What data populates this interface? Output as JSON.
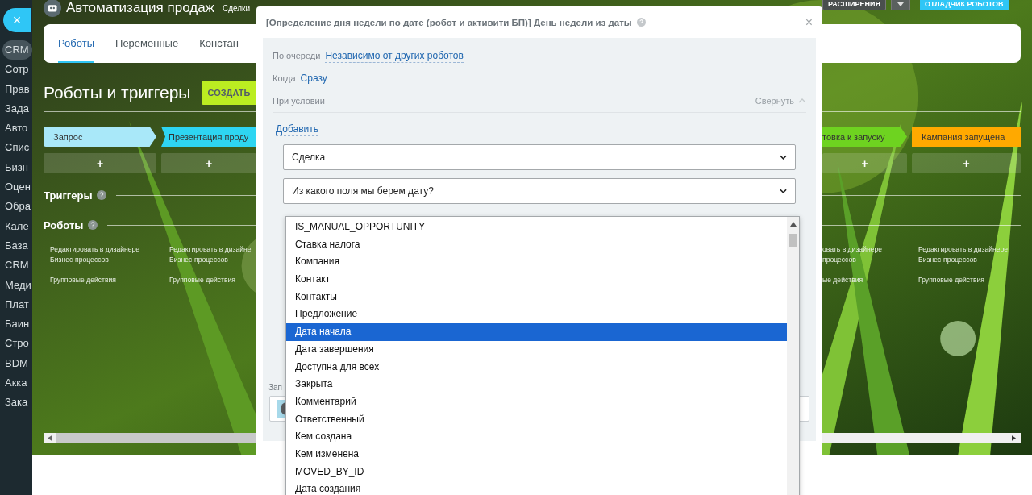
{
  "sidebar": {
    "close": "×",
    "items": [
      {
        "label": "CRM",
        "selected": true
      },
      {
        "label": "Сотр",
        "selected": false
      },
      {
        "label": "Прав",
        "selected": false
      },
      {
        "label": "Зада",
        "selected": false
      },
      {
        "label": "Авто",
        "selected": false
      },
      {
        "label": "Спис",
        "selected": false
      },
      {
        "label": "Бизн",
        "selected": false
      },
      {
        "label": "Оцен",
        "selected": false
      },
      {
        "label": "Обра",
        "selected": false
      },
      {
        "label": "Кале",
        "selected": false
      },
      {
        "label": "База",
        "selected": false
      },
      {
        "label": "CRM",
        "selected": false
      },
      {
        "label": "Меди",
        "selected": false
      },
      {
        "label": "Плат",
        "selected": false
      },
      {
        "label": "Баин",
        "selected": false
      },
      {
        "label": "Стро",
        "selected": false
      },
      {
        "label": "BDM",
        "selected": false
      },
      {
        "label": "Акка",
        "selected": false
      },
      {
        "label": "Зака",
        "selected": false
      }
    ]
  },
  "header": {
    "title": "Автоматизация продаж",
    "breadcrumb": "Сделки"
  },
  "toolbar": {
    "extensions": "РАСШИРЕНИЯ",
    "debugger": "ОТЛАДЧИК РОБОТОВ"
  },
  "tabs": [
    {
      "label": "Роботы",
      "selected": true
    },
    {
      "label": "Переменные",
      "selected": false
    },
    {
      "label": "Констан",
      "selected": false
    }
  ],
  "section_title": "Роботы и триггеры",
  "create_button": "СОЗДАТЬ",
  "triggers_label": "Триггеры",
  "robots_label": "Роботы",
  "left_columns": [
    {
      "stage": "Запрос",
      "color": "#a9e8f9",
      "add": "+",
      "edit_lines": [
        "Редактировать в дизайнере",
        "Бизнес-процессов"
      ],
      "group": "Групповые действия"
    },
    {
      "stage": "Презентация проду",
      "color": "#2ed5f2",
      "add": "+",
      "edit_lines": [
        "Редактировать в дизайне",
        "Бизнес-процессов"
      ],
      "group": "Групповые действия"
    }
  ],
  "right_columns": [
    {
      "stage": "товка к запуску",
      "color": "#6ed320",
      "add": "+",
      "edit_lines": [
        "овать в дизайнере",
        "процессов"
      ],
      "group": "ые действия"
    },
    {
      "stage": "Кампания запущена",
      "color": "#ffa900",
      "add": "+",
      "edit_lines": [
        "Редактировать в дизайнере",
        "Бизнес-процессов"
      ],
      "group": "Групповые действия"
    }
  ],
  "modal": {
    "title": "[Определение дня недели по дате (робот и активити БП)] День недели из даты",
    "close": "×",
    "settings": [
      {
        "label": "По очереди",
        "value": "Независимо от других роботов"
      },
      {
        "label": "Когда",
        "value": "Сразу"
      }
    ],
    "condition": {
      "label": "При условии",
      "collapse": "Свернуть",
      "add": "Добавить"
    },
    "selects": [
      "Сделка",
      "Из какого поля мы берем дату?"
    ],
    "responsible_label": "Зап",
    "dropdown": [
      {
        "label": "IS_MANUAL_OPPORTUNITY",
        "selected": false
      },
      {
        "label": "Ставка налога",
        "selected": false
      },
      {
        "label": "Компания",
        "selected": false
      },
      {
        "label": "Контакт",
        "selected": false
      },
      {
        "label": "Контакты",
        "selected": false
      },
      {
        "label": "Предложение",
        "selected": false
      },
      {
        "label": "Дата начала",
        "selected": true
      },
      {
        "label": "Дата завершения",
        "selected": false
      },
      {
        "label": "Доступна для всех",
        "selected": false
      },
      {
        "label": "Закрыта",
        "selected": false
      },
      {
        "label": "Комментарий",
        "selected": false
      },
      {
        "label": "Ответственный",
        "selected": false
      },
      {
        "label": "Кем создана",
        "selected": false
      },
      {
        "label": "Кем изменена",
        "selected": false
      },
      {
        "label": "MOVED_BY_ID",
        "selected": false
      },
      {
        "label": "Дата создания",
        "selected": false
      }
    ]
  }
}
